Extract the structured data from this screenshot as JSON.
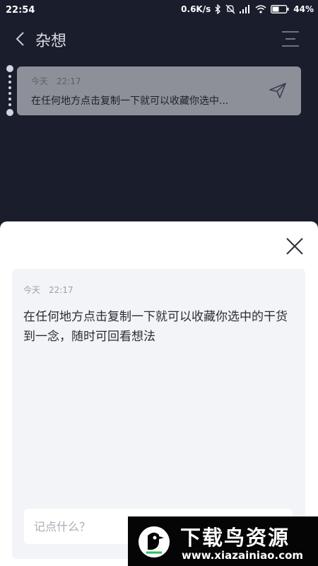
{
  "status_bar": {
    "time": "22:54",
    "network_speed": "0.6K/s",
    "battery": "44%",
    "icons": [
      "bluetooth-icon",
      "mute-icon",
      "signal-icon",
      "wifi-icon",
      "battery-icon"
    ]
  },
  "header": {
    "title": "杂想",
    "back_icon": "chevron-left-icon",
    "menu_icon": "menu-icon"
  },
  "note": {
    "date": "今天",
    "time": "22:17",
    "text": "在任何地方点击复制一下就可以收藏你选中...",
    "send_icon": "send-icon"
  },
  "sheet": {
    "close_icon": "close-icon",
    "detail_date": "今天",
    "detail_time": "22:17",
    "detail_text": "在任何地方点击复制一下就可以收藏你选中的干货到一念，随时可回看想法",
    "input_placeholder": "记点什么？",
    "input_value": ""
  },
  "watermark": {
    "title": "下载鸟资源",
    "url": "www.xiazainiao.com"
  },
  "colors": {
    "background": "#1a1d2c",
    "note_card": "#8d8f99",
    "sheet": "#ffffff",
    "detail_card": "#f3f4f8"
  }
}
